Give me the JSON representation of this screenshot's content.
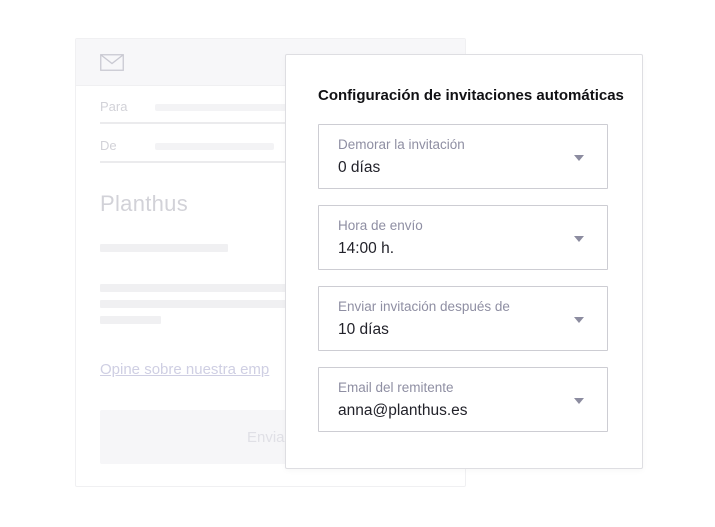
{
  "email_preview": {
    "icon": "envelope-icon",
    "fields": [
      {
        "label": "Para"
      },
      {
        "label": "De"
      }
    ],
    "brand": "Planthus",
    "feedback_link": "Opine sobre nuestra emp",
    "send_button": "Envia"
  },
  "settings": {
    "title": "Configuración de invitaciones automáticas",
    "selects": [
      {
        "label": "Demorar la invitación",
        "value": "0 días",
        "icon": "chevron-down-icon"
      },
      {
        "label": "Hora de envío",
        "value": "14:00 h.",
        "icon": "chevron-down-icon"
      },
      {
        "label": "Enviar invitación después de",
        "value": "10 días",
        "icon": "chevron-down-icon"
      },
      {
        "label": "Email del remitente",
        "value": "anna@planthus.es",
        "icon": "chevron-down-icon"
      }
    ]
  },
  "colors": {
    "panel_border": "#dedee2",
    "label_text": "#8f8fa3",
    "value_text": "#22222a",
    "placeholder": "#f0f0f2",
    "link": "#cfcfe3"
  }
}
